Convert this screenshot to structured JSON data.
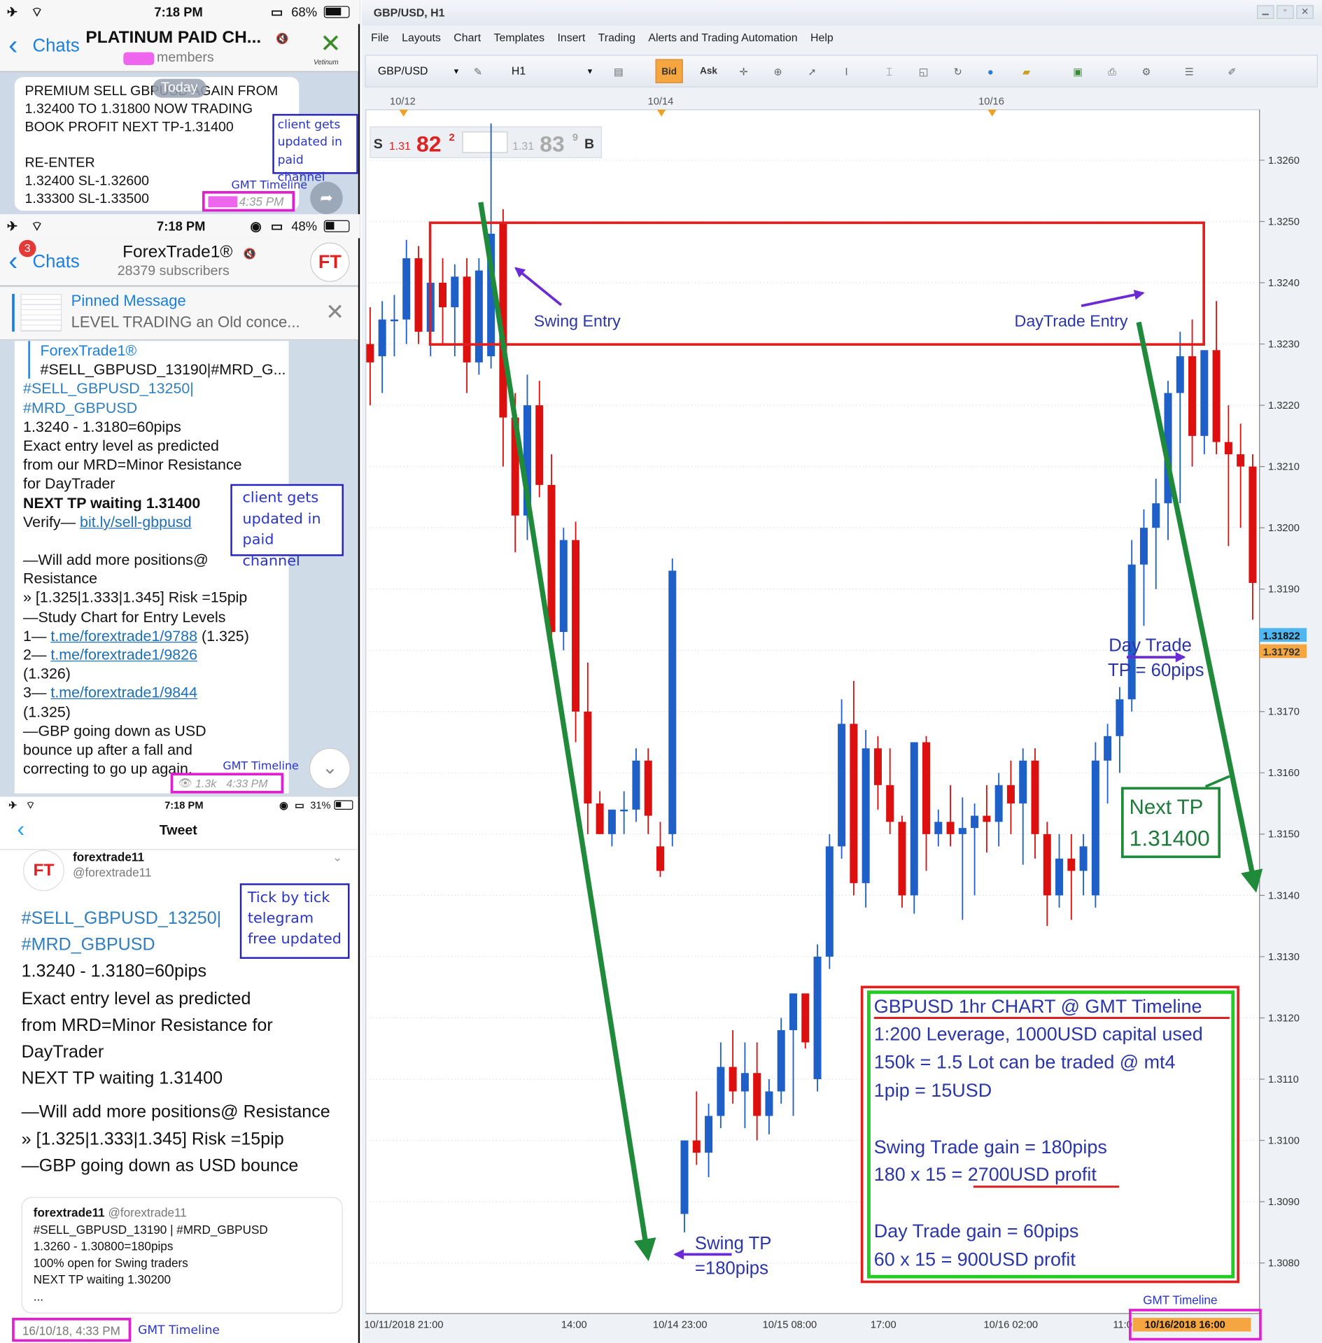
{
  "screen1": {
    "time": "7:18 PM",
    "battery": "68%",
    "back": "Chats",
    "title": "PLATINUM PAID CH...",
    "subtitle": "members",
    "logo": "Vetinum",
    "date_pill": "Today",
    "msg1": "PREMIUM SELL GBPUSD AGAIN FROM",
    "msg2": "1.32400 TO 1.31800 NOW TRADING",
    "msg3": "BOOK PROFIT NEXT TP-1.31400",
    "msg4": "RE-ENTER",
    "msg5": "1.32400 SL-1.32600",
    "msg6": "1.33300 SL-1.33500",
    "time_label": "4:35 PM",
    "note1": "client gets",
    "note2": "updated in",
    "note3": "paid channel",
    "gmt": "GMT Timeline"
  },
  "screen2": {
    "time": "7:18 PM",
    "battery": "48%",
    "badge": "3",
    "back": "Chats",
    "title": "ForexTrade1®",
    "subtitle": "28379 subscribers",
    "avatar": "FT",
    "pinned_title": "Pinned Message",
    "pinned_text": "LEVEL TRADING an Old conce...",
    "reply_name": "ForexTrade1®",
    "reply_text": "#SELL_GBPUSD_13190|#MRD_G...",
    "tag1": "#SELL_GBPUSD_13250|",
    "tag2": "#MRD_GBPUSD",
    "l1": "1.3240 - 1.3180=60pips",
    "l2": "Exact entry level as predicted",
    "l3": "from our MRD=Minor Resistance",
    "l4": "for DayTrader",
    "l5": "NEXT TP waiting 1.31400",
    "l6a": "Verify— ",
    "l6b": "bit.ly/sell-gbpusd",
    "l7": "—Will add more positions@",
    "l8": "Resistance",
    "l9": "» [1.325|1.333|1.345] Risk =15pip",
    "l10": "—Study Chart for Entry Levels",
    "l11a": "1— ",
    "l11b": "t.me/forextrade1/9788",
    "l11c": " (1.325)",
    "l12a": "2— ",
    "l12b": "t.me/forextrade1/9826",
    "l13": "(1.326)",
    "l14a": "3— ",
    "l14b": "t.me/forextrade1/9844",
    "l15": "(1.325)",
    "l16": "—GBP going down as USD",
    "l17": "bounce up after a fall and",
    "l18": "correcting to go up again.",
    "views": "1.3k",
    "time_label": "4:33 PM",
    "note1": "client gets",
    "note2": "updated in",
    "note3": "paid channel",
    "gmt": "GMT Timeline"
  },
  "screen3": {
    "time": "7:18 PM",
    "battery": "31%",
    "title": "Tweet",
    "avatar": "FT",
    "user": "forextrade11",
    "handle": "@forextrade11",
    "tag1": "#SELL_GBPUSD_13250|",
    "tag2": "#MRD_GBPUSD",
    "l1": "1.3240 - 1.3180=60pips",
    "l2": "Exact entry level as predicted",
    "l3": "from MRD=Minor Resistance for",
    "l4": "DayTrader",
    "l5": "NEXT TP waiting 1.31400",
    "l6": "—Will add more positions@ Resistance",
    "l7": "» [1.325|1.333|1.345] Risk =15pip",
    "l8": "—GBP going down as USD bounce",
    "quote_user": "forextrade11",
    "quote_handle": "@forextrade11",
    "q1": "#SELL_GBPUSD_13190 | #MRD_GBPUSD",
    "q2": "1.3260 - 1.30800=180pips",
    "q3": "100% open for Swing traders",
    "q4": "NEXT TP waiting 1.30200",
    "q5": "...",
    "date_label": "16/10/18, 4:33 PM",
    "note1": "Tick by tick",
    "note2": "telegram",
    "note3": "free updated",
    "gmt": "GMT Timeline"
  },
  "platform": {
    "title": "GBP/USD, H1",
    "menu": [
      "File",
      "Layouts",
      "Chart",
      "Templates",
      "Insert",
      "Trading",
      "Alerts and Trading Automation",
      "Help"
    ],
    "symbol": "GBP/USD",
    "timeframe": "H1",
    "bid": "Bid",
    "ask": "Ask",
    "sell_label": "S",
    "sell_small": "1.31",
    "sell_big": "82",
    "sell_sup": "2",
    "buy_small": "1.31",
    "buy_big": "83",
    "buy_sup": "9",
    "buy_label": "B"
  },
  "annotations": {
    "swing_entry": "Swing Entry",
    "daytrade_entry": "DayTrade Entry",
    "daytrade_tp_1": "Day Trade",
    "daytrade_tp_2": "TP = 60pips",
    "swing_tp_1": "Swing TP",
    "swing_tp_2": "=180pips",
    "next_tp_1": "Next TP",
    "next_tp_2": "1.31400",
    "gmt": "GMT Timeline"
  },
  "info_box": {
    "title": "GBPUSD 1hr CHART @ GMT Timeline",
    "line1": "1:200 Leverage, 1000USD capital used",
    "line2": "150k = 1.5 Lot can be traded @ mt4",
    "line3": "1pip = 15USD",
    "line4": "Swing Trade gain = 180pips",
    "line5": "180 x 15 = 2700USD profit",
    "line6": "Day Trade gain = 60pips",
    "line7": "60 x 15 = 900USD profit"
  },
  "colors": {
    "up": "#1f5fc8",
    "down": "#dd1010",
    "zone": "#e02020",
    "trend": "#1e8a3a",
    "annot": "#6a2bd6",
    "annot_text": "#2a35a8"
  },
  "chart_data": {
    "type": "candlestick",
    "symbol": "GBP/USD",
    "timeframe": "H1",
    "ylim": [
      1.3072,
      1.3268
    ],
    "y_ticks": [
      "1.3260",
      "1.3250",
      "1.3240",
      "1.3230",
      "1.3220",
      "1.3210",
      "1.3200",
      "1.3190",
      "1.3180",
      "1.3170",
      "1.3160",
      "1.3150",
      "1.3140",
      "1.3130",
      "1.3120",
      "1.3110",
      "1.3100",
      "1.3090",
      "1.3080"
    ],
    "top_dates": [
      "10/12",
      "10/14",
      "10/16"
    ],
    "x_labels": [
      "10/11/2018 21:00",
      "14:00",
      "10/14 23:00",
      "10/15 08:00",
      "17:00",
      "10/16 02:00",
      "11:00"
    ],
    "last_time": "10/16/2018 16:00",
    "price_tag_1": "1.31822",
    "price_tag_2": "1.31792",
    "ohlc": [
      [
        1.323,
        1.3236,
        1.322,
        1.3227
      ],
      [
        1.3228,
        1.3237,
        1.3222,
        1.3234
      ],
      [
        1.3234,
        1.3238,
        1.3228,
        1.3234
      ],
      [
        1.3234,
        1.3247,
        1.323,
        1.3244
      ],
      [
        1.3244,
        1.3246,
        1.323,
        1.3232
      ],
      [
        1.3232,
        1.324,
        1.3228,
        1.324
      ],
      [
        1.324,
        1.3244,
        1.323,
        1.3236
      ],
      [
        1.3236,
        1.3243,
        1.3228,
        1.3241
      ],
      [
        1.3241,
        1.3244,
        1.3222,
        1.3227
      ],
      [
        1.3227,
        1.3244,
        1.3225,
        1.3242
      ],
      [
        1.3228,
        1.3266,
        1.3226,
        1.3248
      ],
      [
        1.325,
        1.3252,
        1.321,
        1.3218
      ],
      [
        1.3218,
        1.3222,
        1.3196,
        1.3202
      ],
      [
        1.3202,
        1.3225,
        1.3198,
        1.322
      ],
      [
        1.322,
        1.3224,
        1.3205,
        1.3207
      ],
      [
        1.3207,
        1.3212,
        1.318,
        1.3183
      ],
      [
        1.3183,
        1.32,
        1.318,
        1.3198
      ],
      [
        1.3198,
        1.3201,
        1.3165,
        1.317
      ],
      [
        1.317,
        1.3178,
        1.315,
        1.3155
      ],
      [
        1.3155,
        1.3157,
        1.315,
        1.315
      ],
      [
        1.315,
        1.3154,
        1.3148,
        1.3154
      ],
      [
        1.3154,
        1.3157,
        1.315,
        1.3154
      ],
      [
        1.3154,
        1.3164,
        1.3152,
        1.3162
      ],
      [
        1.3162,
        1.3164,
        1.315,
        1.3153
      ],
      [
        1.3148,
        1.3152,
        1.3143,
        1.3144
      ],
      [
        1.315,
        1.3195,
        1.3148,
        1.3193
      ],
      [
        1.3088,
        1.31,
        1.3085,
        1.31
      ],
      [
        1.31,
        1.3108,
        1.3096,
        1.3098
      ],
      [
        1.3098,
        1.3106,
        1.3094,
        1.3104
      ],
      [
        1.3104,
        1.3116,
        1.3102,
        1.3112
      ],
      [
        1.3112,
        1.3118,
        1.3106,
        1.3108
      ],
      [
        1.3108,
        1.3116,
        1.3102,
        1.3111
      ],
      [
        1.3111,
        1.3116,
        1.31,
        1.3104
      ],
      [
        1.3104,
        1.311,
        1.3101,
        1.3108
      ],
      [
        1.3108,
        1.312,
        1.3106,
        1.3118
      ],
      [
        1.3118,
        1.3121,
        1.3104,
        1.3124
      ],
      [
        1.3124,
        1.3122,
        1.3115,
        1.3116
      ],
      [
        1.311,
        1.3132,
        1.3108,
        1.313
      ],
      [
        1.313,
        1.315,
        1.3128,
        1.3148
      ],
      [
        1.3148,
        1.3172,
        1.3146,
        1.3168
      ],
      [
        1.3168,
        1.3175,
        1.314,
        1.3142
      ],
      [
        1.3142,
        1.3167,
        1.3138,
        1.3164
      ],
      [
        1.3164,
        1.3166,
        1.3154,
        1.3158
      ],
      [
        1.3158,
        1.3164,
        1.315,
        1.3152
      ],
      [
        1.3152,
        1.3153,
        1.3138,
        1.314
      ],
      [
        1.314,
        1.3165,
        1.3137,
        1.3165
      ],
      [
        1.3165,
        1.3166,
        1.3144,
        1.315
      ],
      [
        1.315,
        1.3154,
        1.3148,
        1.3152
      ],
      [
        1.3152,
        1.3158,
        1.3148,
        1.315
      ],
      [
        1.315,
        1.3156,
        1.3136,
        1.3151
      ],
      [
        1.3151,
        1.3155,
        1.314,
        1.3153
      ],
      [
        1.3153,
        1.3158,
        1.3147,
        1.3152
      ],
      [
        1.3152,
        1.316,
        1.3148,
        1.3158
      ],
      [
        1.3158,
        1.3162,
        1.315,
        1.3155
      ],
      [
        1.3155,
        1.3164,
        1.3145,
        1.3162
      ],
      [
        1.3162,
        1.3164,
        1.3146,
        1.315
      ],
      [
        1.315,
        1.3152,
        1.3135,
        1.314
      ],
      [
        1.314,
        1.315,
        1.3138,
        1.3146
      ],
      [
        1.3146,
        1.315,
        1.3136,
        1.3144
      ],
      [
        1.3144,
        1.315,
        1.314,
        1.3148
      ],
      [
        1.314,
        1.3165,
        1.3138,
        1.3162
      ],
      [
        1.3162,
        1.3168,
        1.3155,
        1.3166
      ],
      [
        1.3166,
        1.3174,
        1.316,
        1.3172
      ],
      [
        1.3172,
        1.3198,
        1.317,
        1.3194
      ],
      [
        1.3194,
        1.3203,
        1.3184,
        1.32
      ],
      [
        1.32,
        1.3208,
        1.319,
        1.3204
      ],
      [
        1.3204,
        1.3224,
        1.3198,
        1.3222
      ],
      [
        1.3222,
        1.3232,
        1.3204,
        1.3228
      ],
      [
        1.3228,
        1.3234,
        1.321,
        1.3215
      ],
      [
        1.3215,
        1.3228,
        1.3212,
        1.3229
      ],
      [
        1.3229,
        1.3237,
        1.3212,
        1.3214
      ],
      [
        1.3214,
        1.322,
        1.3197,
        1.3212
      ],
      [
        1.3212,
        1.3217,
        1.32,
        1.321
      ],
      [
        1.321,
        1.3212,
        1.3185,
        1.3191
      ]
    ]
  },
  "pdf_extra": ""
}
